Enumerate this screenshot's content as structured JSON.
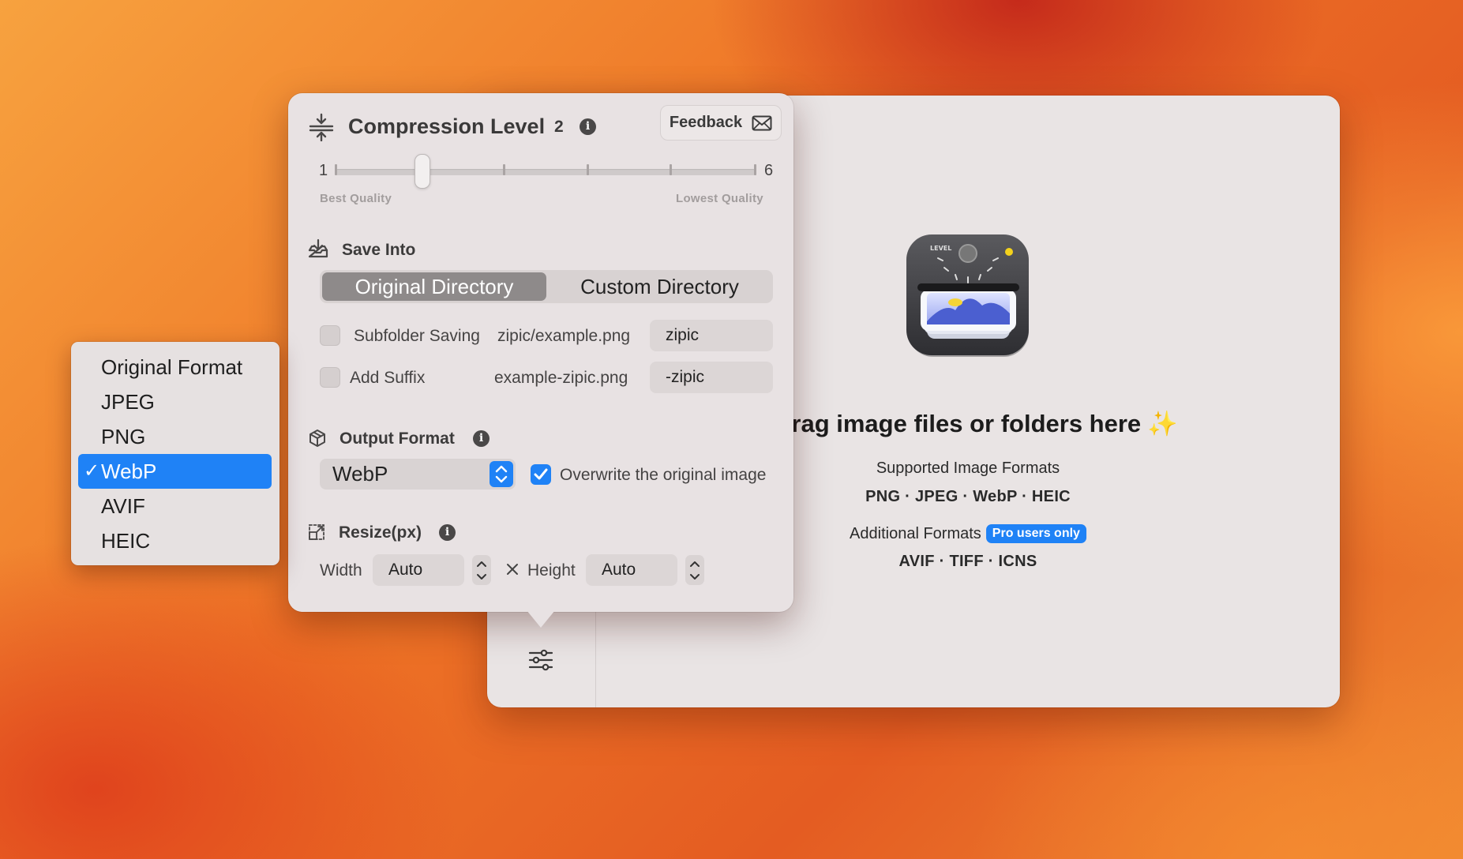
{
  "colors": {
    "accent": "#1f82f6",
    "window_bg": "#e9e4e4",
    "popover_bg": "#e8e2e3"
  },
  "popover": {
    "compression": {
      "title": "Compression Level",
      "value": "2",
      "icon": "compress-arrows-icon",
      "slider": {
        "min_label": "1",
        "max_label": "6",
        "min": 1,
        "max": 6,
        "current": 2,
        "left_hint": "Best Quality",
        "right_hint": "Lowest Quality"
      }
    },
    "feedback": {
      "label": "Feedback",
      "icon": "envelope-icon"
    },
    "save_into": {
      "title": "Save Into",
      "icon": "tray-download-icon",
      "options": [
        "Original Directory",
        "Custom Directory"
      ],
      "selected": "Original Directory",
      "subfolder": {
        "label": "Subfolder Saving",
        "example": "zipic/example.png",
        "value": "zipic",
        "checked": false
      },
      "suffix": {
        "label": "Add Suffix",
        "example": "example-zipic.png",
        "value": "-zipic",
        "checked": false
      }
    },
    "output_format": {
      "title": "Output Format",
      "icon": "cube-icon",
      "selected": "WebP",
      "overwrite_label": "Overwrite the original image",
      "overwrite_checked": true
    },
    "resize": {
      "title": "Resize(px)",
      "icon": "resize-icon",
      "width_label": "Width",
      "width_value": "Auto",
      "height_label": "Height",
      "height_value": "Auto"
    }
  },
  "format_menu": {
    "items": [
      "Original Format",
      "JPEG",
      "PNG",
      "WebP",
      "AVIF",
      "HEIC"
    ],
    "selected": "WebP"
  },
  "drop_zone": {
    "title": "Drag image files or folders here",
    "sparkle": "✨",
    "supported_label": "Supported Image Formats",
    "supported_list": "PNG · JPEG · WebP · HEIC",
    "additional_label": "Additional Formats",
    "pro_badge": "Pro users only",
    "additional_list": "AVIF · TIFF · ICNS"
  },
  "sidebar": {
    "settings_icon": "sliders-icon"
  }
}
